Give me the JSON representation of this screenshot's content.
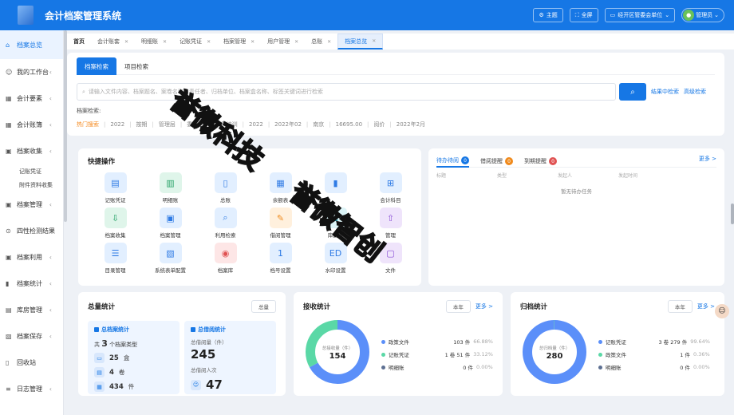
{
  "app": {
    "title": "会计档案管理系统"
  },
  "topbar": {
    "theme": "主题",
    "fullscreen": "全屏",
    "org": "经开区管委会单位",
    "user": "管理员"
  },
  "sidebar": {
    "items": [
      {
        "label": "档案总览",
        "icon": "home-icon",
        "active": true
      },
      {
        "label": "我的工作台",
        "icon": "user-icon",
        "arrow": true
      },
      {
        "label": "会计要素",
        "icon": "grid-icon",
        "arrow": true
      },
      {
        "label": "会计账簿",
        "icon": "grid-icon",
        "arrow": true
      },
      {
        "label": "档案收集",
        "icon": "folder-icon",
        "arrow": true,
        "children": [
          "记账凭证",
          "附件资料收集"
        ]
      },
      {
        "label": "档案管理",
        "icon": "folder-icon",
        "arrow": true
      },
      {
        "label": "四性检测结果",
        "icon": "check-icon"
      },
      {
        "label": "档案利用",
        "icon": "folder-icon",
        "arrow": true
      },
      {
        "label": "档案统计",
        "icon": "chart-icon",
        "arrow": true
      },
      {
        "label": "库房管理",
        "icon": "warehouse-icon",
        "arrow": true
      },
      {
        "label": "档案保存",
        "icon": "save-icon",
        "arrow": true
      },
      {
        "label": "回收站",
        "icon": "trash-icon"
      },
      {
        "label": "日志管理",
        "icon": "log-icon",
        "arrow": true
      }
    ]
  },
  "tabs": [
    {
      "label": "首页",
      "closable": false
    },
    {
      "label": "会计账套",
      "closable": true
    },
    {
      "label": "明细账",
      "closable": true
    },
    {
      "label": "记账凭证",
      "closable": true
    },
    {
      "label": "档案管理",
      "closable": true
    },
    {
      "label": "用户管理",
      "closable": true
    },
    {
      "label": "总账",
      "closable": true
    },
    {
      "label": "档案总览",
      "closable": true,
      "active": true
    }
  ],
  "search": {
    "segments": [
      "档案检索",
      "项目检索"
    ],
    "placeholder": "请输入文件内容、档案题名、案卷名称、责任者、归档单位、档案盒名称、标签关键词进行检索",
    "result_search": "结果中检索",
    "advanced": "高级检索",
    "hint": "档案检索:",
    "hot_label": "热门搜索",
    "hot": [
      "2022",
      "按期",
      "管理层",
      "委员会",
      "素质培训",
      "2022",
      "2022年02",
      "南京",
      "16695.00",
      "阅价",
      "2022年2月"
    ]
  },
  "quick": {
    "title": "快捷操作",
    "items": [
      {
        "label": "记账凭证",
        "icon": "voucher-icon",
        "color": "blue",
        "glyph": "▤"
      },
      {
        "label": "明细账",
        "icon": "ledger-icon",
        "color": "green",
        "glyph": "▥"
      },
      {
        "label": "总账",
        "icon": "book-icon",
        "color": "blue",
        "glyph": "▯"
      },
      {
        "label": "余额表",
        "icon": "table-icon",
        "color": "blue",
        "glyph": "▦"
      },
      {
        "label": "",
        "icon": "chart-icon",
        "color": "blue",
        "glyph": "▮"
      },
      {
        "label": "会计科目",
        "icon": "hierarchy-icon",
        "color": "blue",
        "glyph": "⊞"
      },
      {
        "label": "档案收集",
        "icon": "download-icon",
        "color": "green",
        "glyph": "⇩"
      },
      {
        "label": "档案管理",
        "icon": "folder-icon",
        "color": "blue",
        "glyph": "▣"
      },
      {
        "label": "利用检索",
        "icon": "search-icon",
        "color": "blue",
        "glyph": "⌕"
      },
      {
        "label": "借阅管理",
        "icon": "borrow-icon",
        "color": "orange",
        "glyph": "✎"
      },
      {
        "label": "库房管",
        "icon": "warehouse-icon",
        "color": "cyan",
        "glyph": "⌂"
      },
      {
        "label": "管理",
        "icon": "upload-icon",
        "color": "purple",
        "glyph": "⇧"
      },
      {
        "label": "目录管理",
        "icon": "list-icon",
        "color": "blue",
        "glyph": "☰"
      },
      {
        "label": "系统表单配置",
        "icon": "form-icon",
        "color": "blue",
        "glyph": "▧"
      },
      {
        "label": "档案库",
        "icon": "database-icon",
        "color": "red",
        "glyph": "◉"
      },
      {
        "label": "档号设置",
        "icon": "number-icon",
        "color": "blue",
        "glyph": "1"
      },
      {
        "label": "水印设置",
        "icon": "watermark-icon",
        "color": "blue",
        "glyph": "ED"
      },
      {
        "label": "文件",
        "icon": "file-icon",
        "color": "purple",
        "glyph": "▢"
      }
    ]
  },
  "todo": {
    "tabs": [
      {
        "label": "待办待阅",
        "count": "0",
        "color": "#1677e5"
      },
      {
        "label": "借阅提醒",
        "count": "0",
        "color": "#f08a1c"
      },
      {
        "label": "到期提醒",
        "count": "0",
        "color": "#e05252"
      }
    ],
    "more": "更多 >",
    "headers": [
      "标题",
      "类型",
      "发起人",
      "发起时间"
    ],
    "empty": "暂无待办任务"
  },
  "total_stats": {
    "title": "总量统计",
    "select": "总量",
    "archive_box": {
      "title": "总档案统计",
      "type_prefix": "共",
      "type_count": "3",
      "type_suffix": "个档案类型",
      "rows": [
        {
          "icon": "box-icon",
          "value": "25",
          "unit": "盒"
        },
        {
          "icon": "volume-icon",
          "value": "4",
          "unit": "卷"
        },
        {
          "icon": "item-icon",
          "value": "434",
          "unit": "件"
        }
      ]
    },
    "borrow_box": {
      "title": "总借阅统计",
      "sub1": "总借阅量（件）",
      "num1": "245",
      "sub2": "总借阅人次",
      "num2": "47"
    }
  },
  "receive_stats": {
    "title": "接收统计",
    "select": "本年",
    "more": "更多 >",
    "center_label": "总接收量（件）",
    "center_value": "154",
    "legend": [
      {
        "name": "政策文件",
        "count": "103 件",
        "pct": "66.88%",
        "color": "#5b8ff9"
      },
      {
        "name": "记账凭证",
        "count": "1 卷 51 件",
        "pct": "33.12%",
        "color": "#5ad8a6"
      },
      {
        "name": "明细账",
        "count": "0 件",
        "pct": "0.00%",
        "color": "#5d7092"
      }
    ]
  },
  "archive_stats": {
    "title": "归档统计",
    "select": "本年",
    "more": "更多 >",
    "center_label": "总归档量（件）",
    "center_value": "280",
    "legend": [
      {
        "name": "记账凭证",
        "count": "3 卷 279 件",
        "pct": "99.64%",
        "color": "#5b8ff9"
      },
      {
        "name": "政策文件",
        "count": "1 件",
        "pct": "0.36%",
        "color": "#5ad8a6"
      },
      {
        "name": "明细账",
        "count": "0 件",
        "pct": "0.00%",
        "color": "#5d7092"
      }
    ]
  },
  "watermark": {
    "line1": "誉微科技",
    "line2": "誉微智创"
  }
}
